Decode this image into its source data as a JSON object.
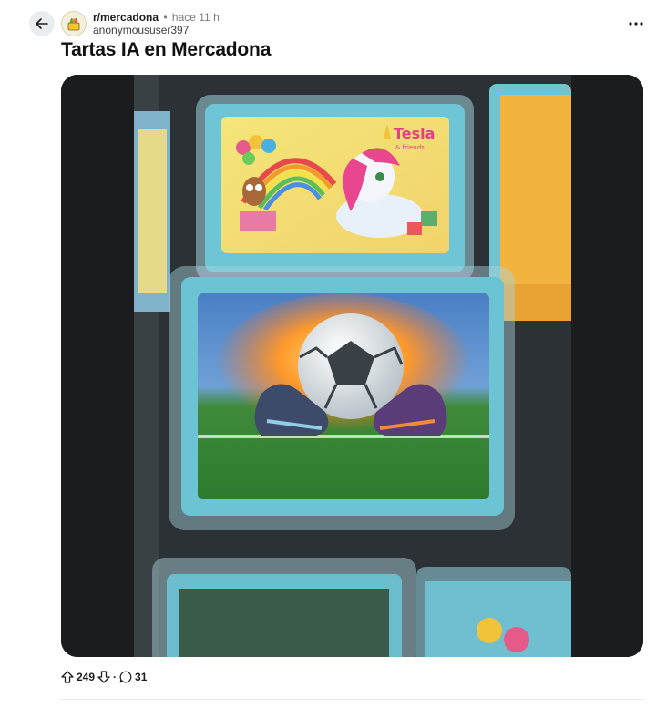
{
  "post": {
    "subreddit": "r/mercadona",
    "separator": "•",
    "time": "hace 11 h",
    "author": "anonymoususer397",
    "title": "Tartas IA en Mercadona",
    "votes": "249",
    "comment_sep": "·",
    "comments": "31"
  },
  "cake_top": {
    "brand": "Tesla",
    "brand_sub": "& friends"
  },
  "icons": {
    "back": "arrow-left-icon",
    "more": "ellipsis-icon",
    "upvote": "arrow-up-icon",
    "downvote": "arrow-down-icon",
    "comment": "comment-bubble-icon"
  },
  "colors": {
    "accent_bg": "#eaedef",
    "text": "#1a1a1b",
    "muted": "#7c7c7c"
  }
}
